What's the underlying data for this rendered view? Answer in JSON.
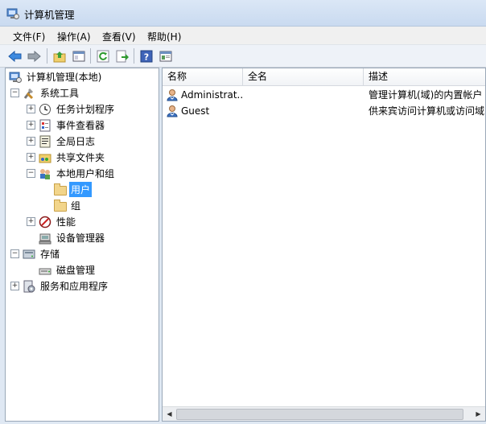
{
  "window": {
    "title": "计算机管理",
    "icon": "computer-management-icon"
  },
  "menu": [
    "文件(F)",
    "操作(A)",
    "查看(V)",
    "帮助(H)"
  ],
  "toolbar": [
    "back-icon",
    "forward-icon",
    "up-folder-icon",
    "show-hide-tree-icon",
    "refresh-icon",
    "export-icon",
    "help-icon",
    "properties-icon"
  ],
  "tree": {
    "root": "计算机管理(本地)",
    "system_tools": "系统工具",
    "task_scheduler": "任务计划程序",
    "event_viewer": "事件查看器",
    "global_log": "全局日志",
    "shared_folders": "共享文件夹",
    "local_users": "本地用户和组",
    "users": "用户",
    "groups": "组",
    "performance": "性能",
    "device_manager": "设备管理器",
    "storage": "存储",
    "disk_management": "磁盘管理",
    "services_apps": "服务和应用程序"
  },
  "list": {
    "columns": [
      "名称",
      "全名",
      "描述"
    ],
    "rows": [
      {
        "name": "Administrat...",
        "full_name": "",
        "description": "管理计算机(域)的内置帐户"
      },
      {
        "name": "Guest",
        "full_name": "",
        "description": "供来宾访问计算机或访问域"
      }
    ]
  },
  "colors": {
    "selection": "#3399ff",
    "titlebar": "#c9daf0"
  }
}
